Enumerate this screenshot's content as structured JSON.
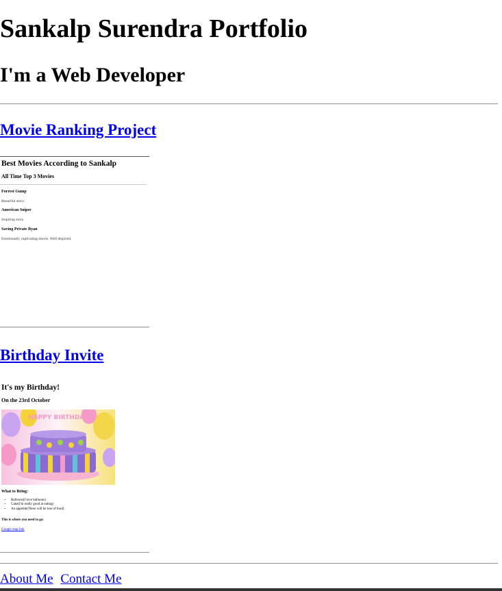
{
  "header": {
    "title": "Sankalp Surendra Portfolio",
    "subtitle": "I'm a Web Developer"
  },
  "projects": [
    {
      "link_label": "Movie Ranking Project",
      "preview": {
        "title": "Best Movies According to Sankalp",
        "subtitle": "All Time Top 3 Movies",
        "movies": [
          {
            "name": "Forrest Gump",
            "description": "Beautiful story."
          },
          {
            "name": "American Sniper",
            "description": "Inspiring story."
          },
          {
            "name": "Saving Private Ryan",
            "description": "Emotionally captivating movie. Well depicted."
          }
        ]
      }
    },
    {
      "link_label": "Birthday Invite",
      "preview": {
        "title": "It's my Birthday!",
        "subtitle": "On the 23rd October",
        "cake_banner": "HAPPY BIRTHDAY",
        "bring_heading": "What to Bring:",
        "bring_items": [
          "Balloons(I love balloons)",
          "Cake(I'm really good at eating)",
          "An appetite(There will be lots of food)"
        ],
        "where_heading": "This is where you need to go:",
        "map_link": "Google map link"
      }
    }
  ],
  "footer": {
    "about_label": "About Me",
    "contact_label": "Contact Me"
  }
}
